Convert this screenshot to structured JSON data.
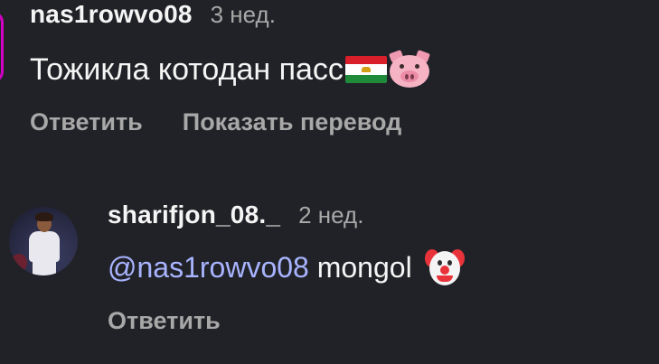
{
  "comments": [
    {
      "username": "nas1rowvo08",
      "time": "3 нед.",
      "text": "Тожикла котодан пасс",
      "emojis": [
        "tajikistan-flag-emoji",
        "pig-face-emoji"
      ],
      "actions": {
        "reply": "Ответить",
        "translate": "Показать перевод"
      }
    },
    {
      "username": "sharifjon_08._",
      "time": "2 нед.",
      "mention": "@nas1rowvo08",
      "text": " mongol",
      "emojis": [
        "clown-face-emoji"
      ],
      "actions": {
        "reply": "Ответить"
      }
    }
  ],
  "colors": {
    "background": "#212227",
    "mention": "#a8b4ff",
    "muted": "#a8a8a8",
    "story_ring": "#d300c5"
  }
}
